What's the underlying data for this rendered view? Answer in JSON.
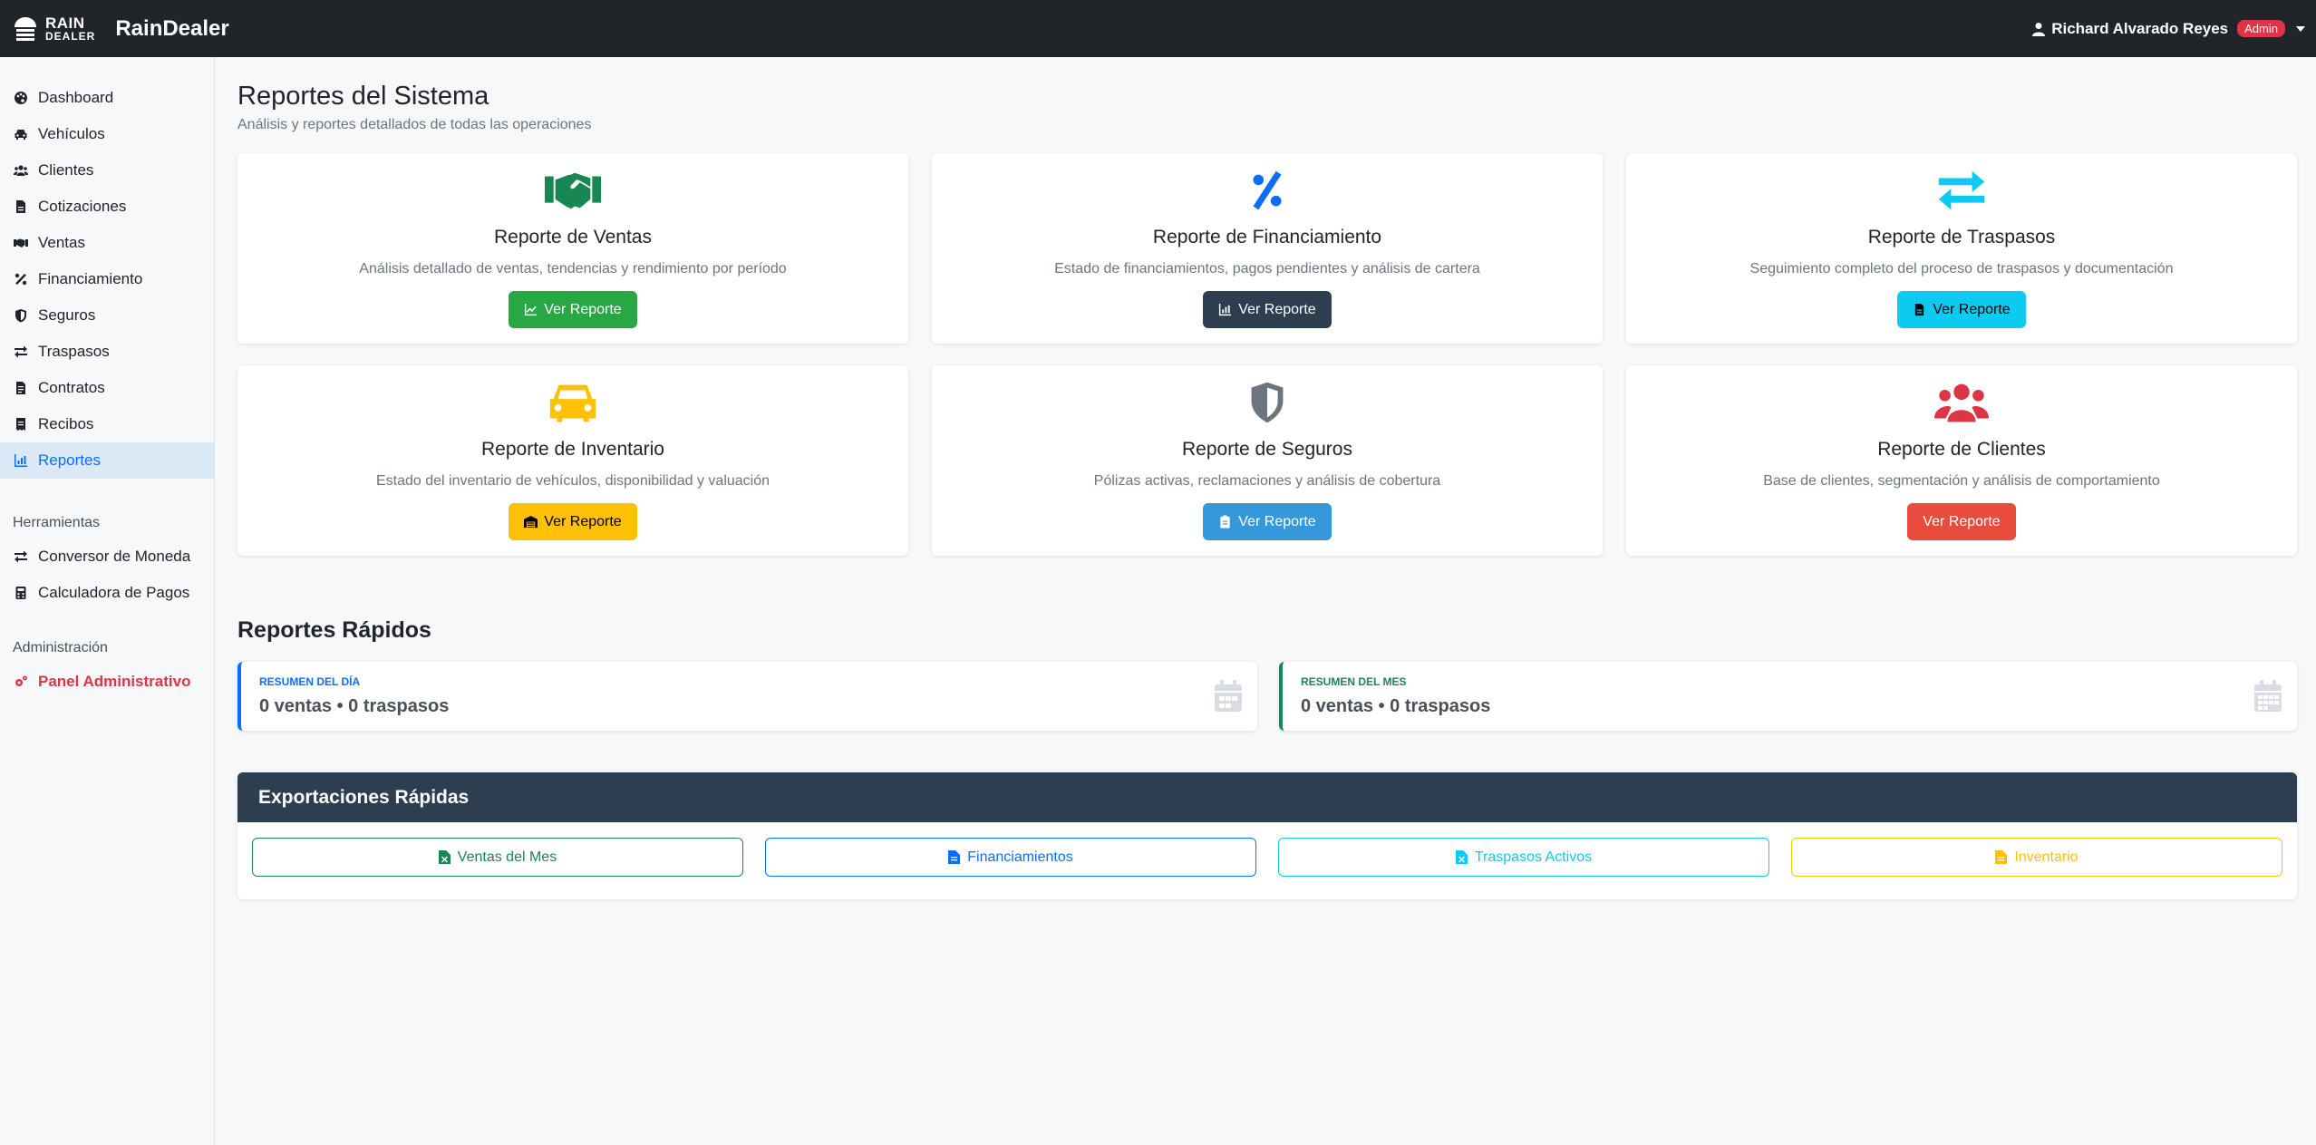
{
  "header": {
    "logo_line1": "RAIN",
    "logo_line2": "DEALER",
    "brand": "RainDealer",
    "user_name": "Richard Alvarado Reyes",
    "role_badge": "Admin"
  },
  "sidebar": {
    "items": [
      {
        "label": "Dashboard",
        "icon": "palette-icon"
      },
      {
        "label": "Vehículos",
        "icon": "car-icon"
      },
      {
        "label": "Clientes",
        "icon": "users-icon"
      },
      {
        "label": "Cotizaciones",
        "icon": "file-invoice-icon"
      },
      {
        "label": "Ventas",
        "icon": "handshake-icon"
      },
      {
        "label": "Financiamiento",
        "icon": "percent-icon"
      },
      {
        "label": "Seguros",
        "icon": "shield-icon"
      },
      {
        "label": "Traspasos",
        "icon": "exchange-icon"
      },
      {
        "label": "Contratos",
        "icon": "file-contract-icon"
      },
      {
        "label": "Recibos",
        "icon": "receipt-icon"
      },
      {
        "label": "Reportes",
        "icon": "chart-icon",
        "active": true
      }
    ],
    "tools_heading": "Herramientas",
    "tools": [
      {
        "label": "Conversor de Moneda",
        "icon": "exchange-icon"
      },
      {
        "label": "Calculadora de Pagos",
        "icon": "calculator-icon"
      }
    ],
    "admin_heading": "Administración",
    "admin_item": "Panel Administrativo"
  },
  "main": {
    "title": "Reportes del Sistema",
    "subtitle": "Análisis y reportes detallados de todas las operaciones",
    "cards": [
      {
        "title": "Reporte de Ventas",
        "desc": "Análisis detallado de ventas, tendencias y rendimiento por período",
        "button": "Ver Reporte",
        "icon": "handshake-icon",
        "color": "#198754"
      },
      {
        "title": "Reporte de Financiamiento",
        "desc": "Estado de financiamientos, pagos pendientes y análisis de cartera",
        "button": "Ver Reporte",
        "icon": "percent-icon",
        "color": "#2c3e50"
      },
      {
        "title": "Reporte de Traspasos",
        "desc": "Seguimiento completo del proceso de traspasos y documentación",
        "button": "Ver Reporte",
        "icon": "exchange-icon",
        "color": "#0dcaf0"
      },
      {
        "title": "Reporte de Inventario",
        "desc": "Estado del inventario de vehículos, disponibilidad y valuación",
        "button": "Ver Reporte",
        "icon": "car-icon",
        "color": "#ffc107"
      },
      {
        "title": "Reporte de Seguros",
        "desc": "Pólizas activas, reclamaciones y análisis de cobertura",
        "button": "Ver Reporte",
        "icon": "shield-icon",
        "color": "#3498db"
      },
      {
        "title": "Reporte de Clientes",
        "desc": "Base de clientes, segmentación y análisis de comportamiento",
        "button": "Ver Reporte",
        "icon": "users-icon",
        "color": "#dc3545"
      }
    ],
    "quick_title": "Reportes Rápidos",
    "summary_day": {
      "label": "Resumen del Día",
      "value": "0 ventas • 0 traspasos"
    },
    "summary_month": {
      "label": "Resumen del Mes",
      "value": "0 ventas • 0 traspasos"
    },
    "export_title": "Exportaciones Rápidas",
    "exports": [
      {
        "label": "Ventas del Mes",
        "color": "#198754"
      },
      {
        "label": "Financiamientos",
        "color": "#0d6efd"
      },
      {
        "label": "Traspasos Activos",
        "color": "#0dcaf0"
      },
      {
        "label": "Inventario",
        "color": "#ffc107"
      }
    ]
  }
}
